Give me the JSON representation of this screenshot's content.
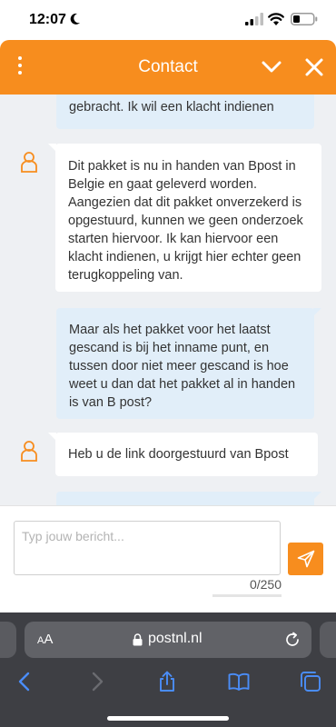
{
  "status_bar": {
    "time": "12:07"
  },
  "header": {
    "title": "Contact"
  },
  "messages": [
    {
      "from": "user",
      "text": "gebracht. Ik wil een klacht indienen"
    },
    {
      "from": "agent",
      "text": "Dit pakket is nu in handen van Bpost in Belgie en gaat geleverd worden. Aangezien dat dit pakket onverzekerd is opgestuurd, kunnen we geen onderzoek starten hiervoor. Ik kan hiervoor een klacht indienen, u krijgt hier echter geen terugkoppeling van."
    },
    {
      "from": "user",
      "text": "Maar als het pakket voor het laatst gescand is bij het inname punt, en tussen door niet meer gescand is hoe weet u dan dat het pakket al in handen is van B post?"
    },
    {
      "from": "agent",
      "text": "Heb u de link doorgestuurd van Bpost"
    }
  ],
  "composer": {
    "placeholder": "Typ jouw bericht...",
    "value": "",
    "char_count": "0/250"
  },
  "browser": {
    "aa_small": "A",
    "aa_large": "A",
    "url": "postnl.nl"
  },
  "colors": {
    "brand": "#f78d1e",
    "user_bubble": "#e1eef9",
    "chat_bg": "#eef0f3",
    "browser_bg": "#3e3f44",
    "ios_blue": "#4a8df8"
  },
  "icons": [
    "moon-icon",
    "signal-icon",
    "wifi-icon",
    "battery-icon",
    "menu-dots-icon",
    "chevron-down-icon",
    "close-icon",
    "agent-avatar-icon",
    "send-icon",
    "lock-icon",
    "reload-icon",
    "back-icon",
    "forward-icon",
    "share-icon",
    "bookmarks-icon",
    "tabs-icon"
  ]
}
